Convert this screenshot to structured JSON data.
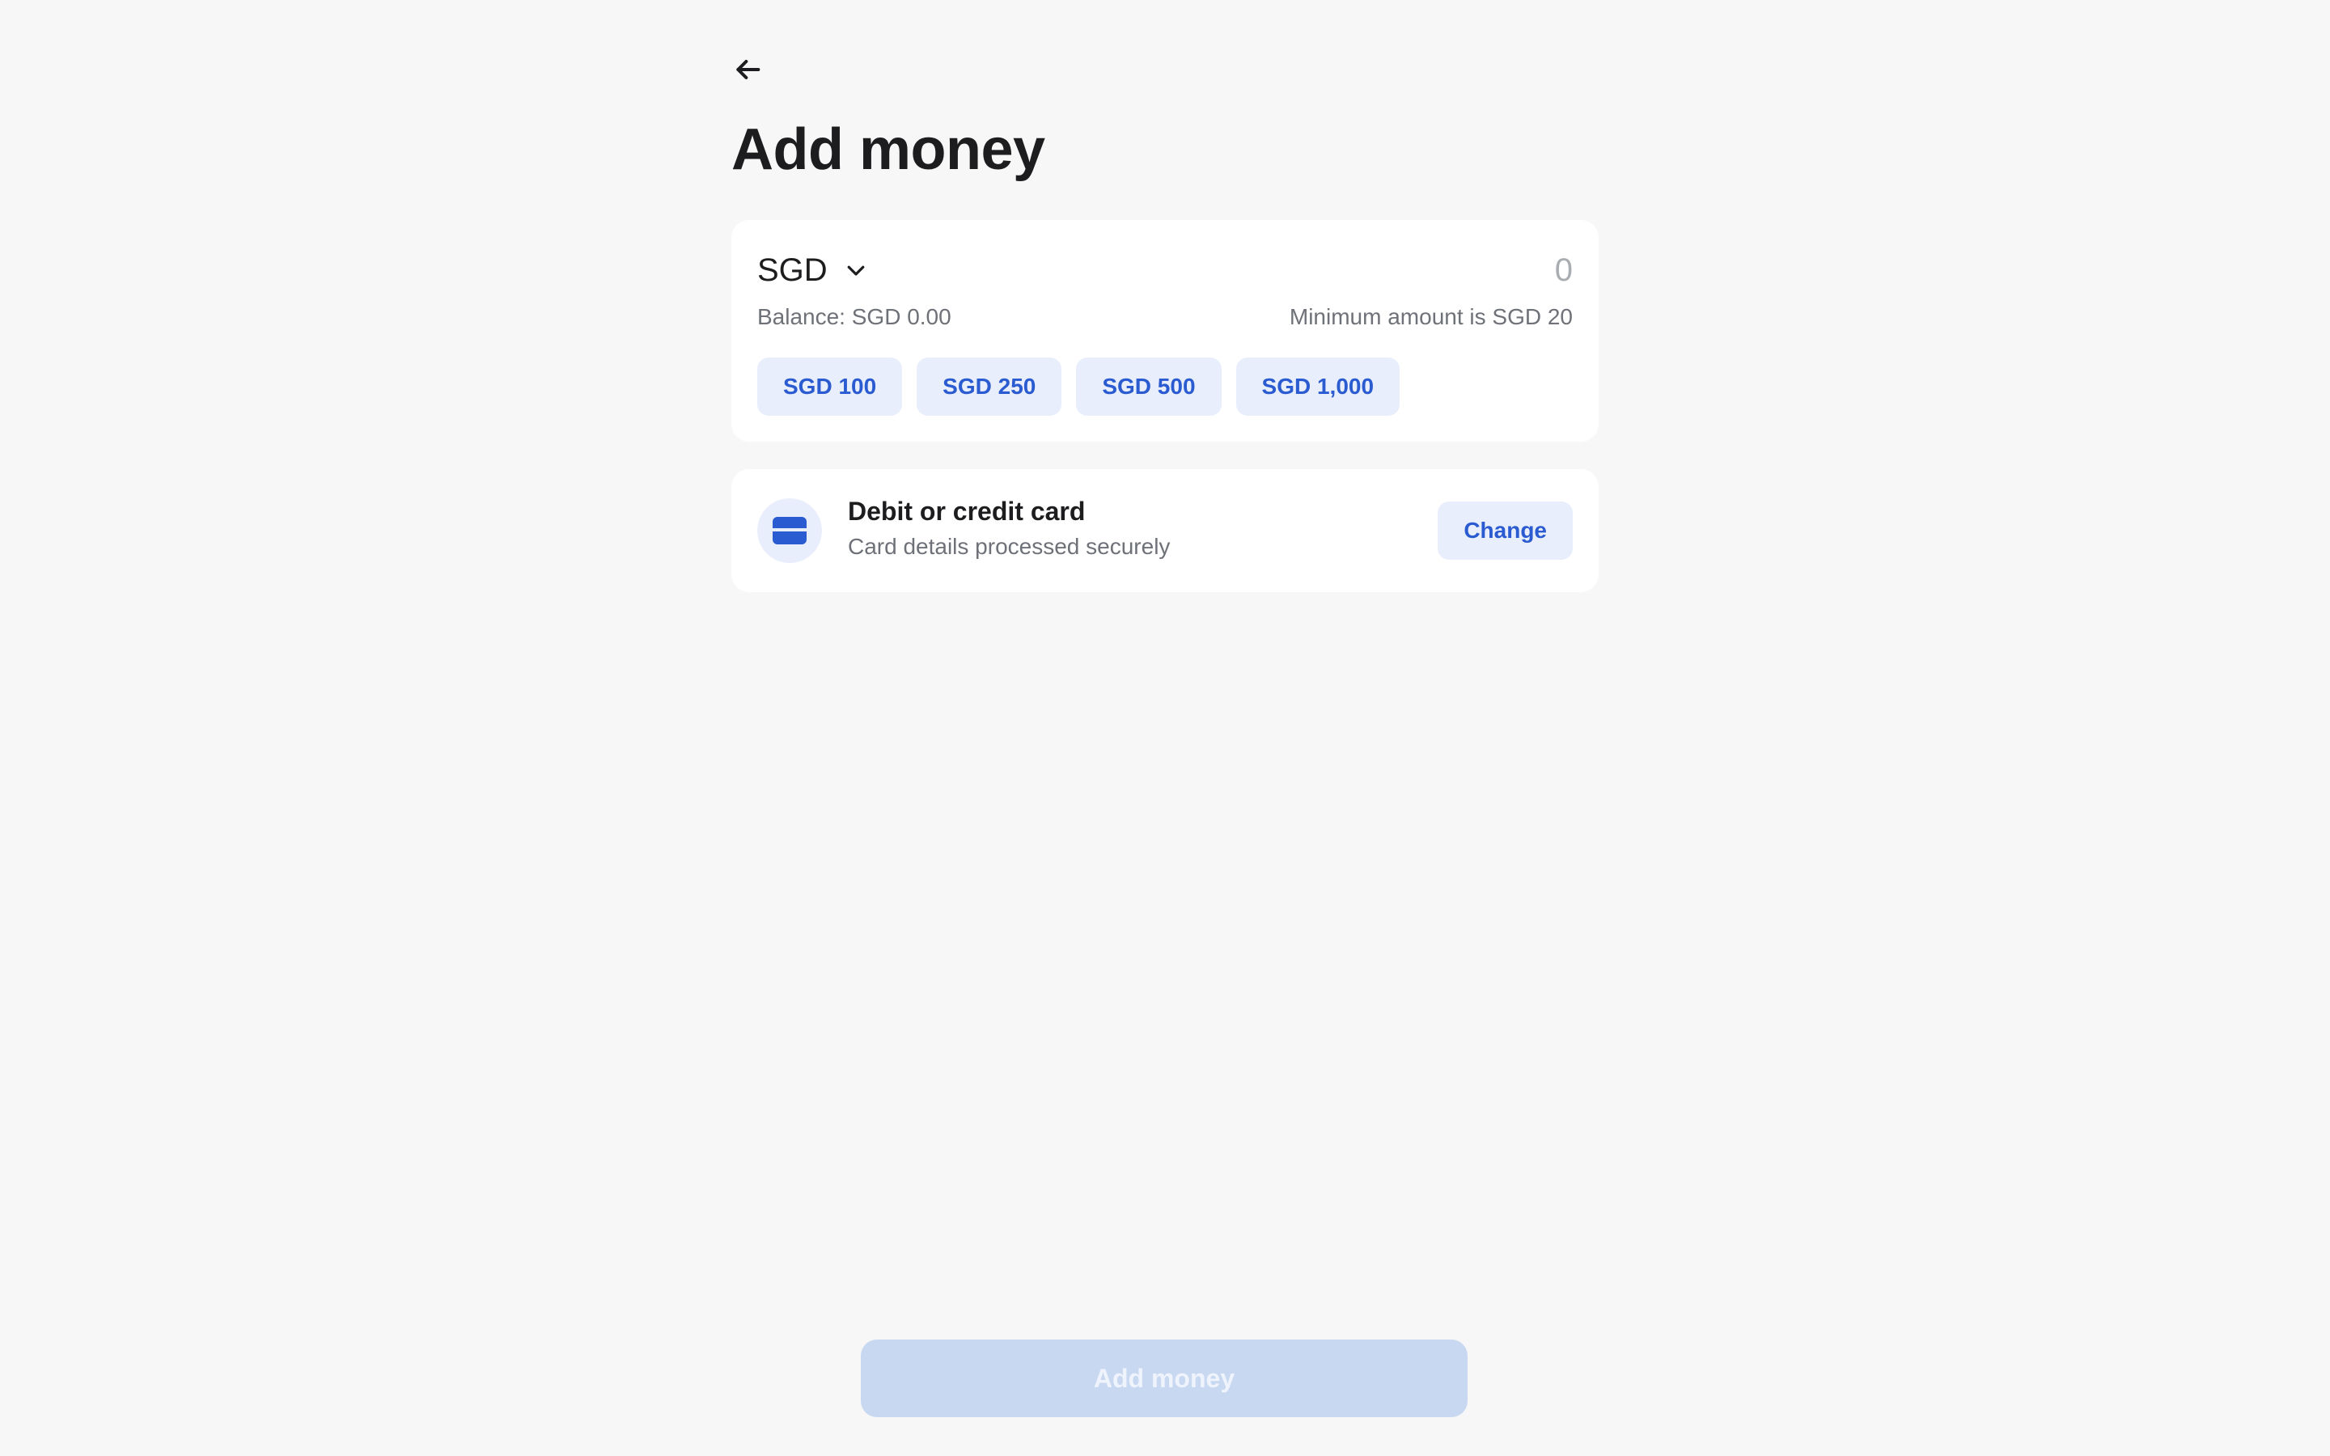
{
  "header": {
    "back_icon": "arrow-left-icon",
    "title": "Add money"
  },
  "amount_card": {
    "currency": "SGD",
    "currency_icon": "chevron-down-icon",
    "amount_value": "",
    "amount_placeholder": "0",
    "balance_text": "Balance: SGD 0.00",
    "minimum_text": "Minimum amount is SGD 20",
    "quick_amounts": [
      "SGD 100",
      "SGD 250",
      "SGD 500",
      "SGD 1,000"
    ]
  },
  "payment_method": {
    "icon": "credit-card-icon",
    "title": "Debit or credit card",
    "subtitle": "Card details processed securely",
    "change_label": "Change"
  },
  "footer": {
    "submit_label": "Add money",
    "submit_disabled": true
  },
  "colors": {
    "background": "#f7f7f7",
    "card": "#ffffff",
    "accent": "#2a5bd0",
    "chip_bg": "#e8eefb",
    "disabled_button": "#c9d8f1",
    "muted_text": "#6e7177"
  }
}
